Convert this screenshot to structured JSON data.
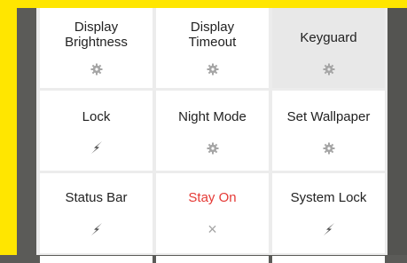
{
  "tiles": [
    {
      "label_line1": "Display",
      "label_line2": "Brightness",
      "icon": "gear-icon"
    },
    {
      "label_line1": "Display",
      "label_line2": "Timeout",
      "icon": "gear-icon"
    },
    {
      "label_line1": "Keyguard",
      "label_line2": "",
      "icon": "gear-icon"
    },
    {
      "label_line1": "Lock",
      "label_line2": "",
      "icon": "bolt-icon"
    },
    {
      "label_line1": "Night Mode",
      "label_line2": "",
      "icon": "gear-icon"
    },
    {
      "label_line1": "Set Wallpaper",
      "label_line2": "",
      "icon": "gear-icon"
    },
    {
      "label_line1": "Status Bar",
      "label_line2": "",
      "icon": "bolt-icon"
    },
    {
      "label_line1": "Stay On",
      "label_line2": "",
      "icon": "close-icon"
    },
    {
      "label_line1": "System Lock",
      "label_line2": "",
      "icon": "bolt-icon"
    }
  ],
  "colors": {
    "frame": "#ffe600",
    "accent_red": "#e53935",
    "icon_gray": "#a5a5a5"
  },
  "close_glyph": "×"
}
